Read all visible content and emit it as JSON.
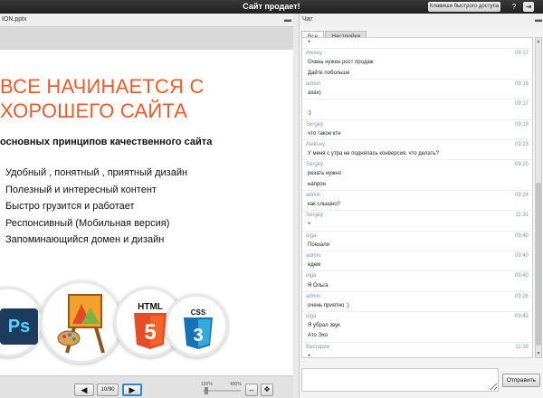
{
  "topbar": {
    "title": "Сайт продает!",
    "hotkeys_label": "Клавиши быстрого доступа",
    "help_icon": "?",
    "exit_icon": "⇥"
  },
  "presentation": {
    "filename": "ION.pptx",
    "slide": {
      "heading_line1": "ВСЕ НАЧИНАЕТСЯ С",
      "heading_line2": "ХОРОШЕГО САЙТА",
      "subtitle": "основных принципов качественного сайта",
      "bullets": [
        "Удобный , понятный , приятный дизайн",
        "Полезный и интересный контент",
        "Быстро грузится и работает",
        "Респонсивный (Мобильная версия)",
        "Запоминающийся домен и дизайн"
      ],
      "logos": {
        "ps": "Ps",
        "html": "HTML",
        "html_num": "5",
        "css": "CSS",
        "css_num": "3"
      }
    },
    "nav": {
      "page_display": "10/90",
      "zoom_min": "100%",
      "zoom_max": "400%"
    }
  },
  "chat": {
    "title": "Чат",
    "tabs": [
      "Все",
      "Настройки"
    ],
    "messages": [
      {
        "name": "",
        "text": "+",
        "time": ""
      },
      {
        "name": "Alexey",
        "text": "",
        "time": "09:17"
      },
      {
        "name": "",
        "text": "Очень нужен рост продаж",
        "time": ""
      },
      {
        "name": "",
        "text": "Дайте побольше",
        "time": ""
      },
      {
        "name": "admin",
        "text": "",
        "time": "09:16"
      },
      {
        "name": "",
        "text": "ахах)",
        "time": ""
      },
      {
        "name": "",
        "text": "",
        "time": "09:17"
      },
      {
        "name": "",
        "text": ":)",
        "time": ""
      },
      {
        "name": "Sergey",
        "text": "",
        "time": "09:19"
      },
      {
        "name": "",
        "text": "что такое ктн",
        "time": ""
      },
      {
        "name": "Aleksey",
        "text": "",
        "time": "09:23"
      },
      {
        "name": "",
        "text": "У меня с утра не поднялась конверсия, что делать?",
        "time": ""
      },
      {
        "name": "Sergey",
        "text": "",
        "time": "09:20"
      },
      {
        "name": "",
        "text": "резать нужно",
        "time": ""
      },
      {
        "name": "",
        "text": "напрон",
        "time": ""
      },
      {
        "name": "admin",
        "text": "",
        "time": "09:24"
      },
      {
        "name": "",
        "text": "как слышно?",
        "time": ""
      },
      {
        "name": "Sergey",
        "text": "",
        "time": "11:31"
      },
      {
        "name": "",
        "text": "+",
        "time": ""
      },
      {
        "name": "olga",
        "text": "",
        "time": "09:40"
      },
      {
        "name": "",
        "text": "Поехали",
        "time": ""
      },
      {
        "name": "admin",
        "text": "",
        "time": "09:40"
      },
      {
        "name": "",
        "text": "едем",
        "time": ""
      },
      {
        "name": "olga",
        "text": "",
        "time": "09:40"
      },
      {
        "name": "",
        "text": "Я Ольга",
        "time": ""
      },
      {
        "name": "admin",
        "text": "",
        "time": "09:26"
      },
      {
        "name": "",
        "text": "очень приятно :)",
        "time": ""
      },
      {
        "name": "olga",
        "text": "",
        "time": "09:42"
      },
      {
        "name": "",
        "text": "Я убрал звук",
        "time": ""
      },
      {
        "name": "",
        "text": "Ато Эхо",
        "time": ""
      },
      {
        "name": "Виктория",
        "text": "",
        "time": "11:39"
      },
      {
        "name": "",
        "text": "+",
        "time": ""
      }
    ],
    "input_value": "",
    "send_label": "Отправить"
  }
}
